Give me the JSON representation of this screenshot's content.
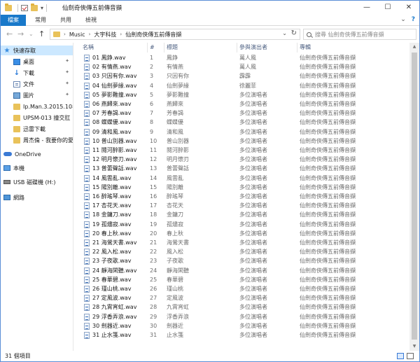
{
  "window": {
    "title": "仙劍奇俠傳五前傳音擷",
    "min_glyph": "—",
    "max_glyph": "☐",
    "close_glyph": "✕"
  },
  "quick_access": {
    "dropdown_glyph": "▾"
  },
  "ribbon": {
    "tabs": [
      "檔案",
      "常用",
      "共用",
      "檢視"
    ],
    "collapse_glyph": "⌄",
    "help_glyph": "?"
  },
  "nav": {
    "back_glyph": "←",
    "forward_glyph": "→",
    "recent_glyph": "⌄",
    "up_glyph": "↑"
  },
  "address": {
    "crumbs": [
      "Music",
      "大宇科技",
      "仙劍奇俠傳五前傳音擷"
    ],
    "chevron": "›",
    "dropdown_glyph": "⌄",
    "refresh_glyph": "↻"
  },
  "search": {
    "placeholder": "搜尋 仙劍奇俠傳五前傳音擷"
  },
  "sidebar": {
    "items": [
      {
        "label": "快速存取",
        "icon": "star-icon",
        "pinned": false
      },
      {
        "label": "桌面",
        "icon": "desktop-icon",
        "pinned": true
      },
      {
        "label": "下載",
        "icon": "download-icon",
        "pinned": true
      },
      {
        "label": "文件",
        "icon": "document-icon",
        "pinned": true
      },
      {
        "label": "圖片",
        "icon": "picture-icon",
        "pinned": true
      },
      {
        "label": "Ip.Man.3.2015.108",
        "icon": "folder-icon",
        "pinned": false
      },
      {
        "label": "UPSM-013 撞交肛",
        "icon": "folder-icon",
        "pinned": false
      },
      {
        "label": "迅雷下載",
        "icon": "folder-icon",
        "pinned": false
      },
      {
        "label": "周杰倫 - 我要你的愛",
        "icon": "folder-icon",
        "pinned": false
      },
      {
        "label": "OneDrive",
        "icon": "cloud-icon",
        "pinned": false
      },
      {
        "label": "本機",
        "icon": "pc-icon",
        "pinned": false
      },
      {
        "label": "USB 磁碟機 (H:)",
        "icon": "usb-icon",
        "pinned": false
      },
      {
        "label": "網路",
        "icon": "network-icon",
        "pinned": false
      }
    ],
    "pin_glyph": "📌"
  },
  "columns": {
    "name": "名稱",
    "number": "#",
    "title": "標題",
    "artist": "參與演出者",
    "album": "專輯",
    "sort_glyph": "^"
  },
  "files": [
    {
      "name": "01 鳳錚.wav",
      "num": "1",
      "title": "鳳錚",
      "artist": "萬人風",
      "album": "仙劍奇俠傳五前傳音擷"
    },
    {
      "name": "02 有情燕.wav",
      "num": "2",
      "title": "有情燕",
      "artist": "萬人風",
      "album": "仙劍奇俠傳五前傳音擷"
    },
    {
      "name": "03 只因有你.wav",
      "num": "3",
      "title": "只因有你",
      "artist": "霹霹",
      "album": "仙劍奇俠傳五前傳音擷"
    },
    {
      "name": "04 仙劍夢緣.wav",
      "num": "4",
      "title": "仙劍夢緣",
      "artist": "徐麗菲",
      "album": "仙劍奇俠傳五前傳音擷"
    },
    {
      "name": "05 夢影難撞.wav",
      "num": "5",
      "title": "夢影難撞",
      "artist": "多位演唱者",
      "album": "仙劍奇俠傳五前傳音擷"
    },
    {
      "name": "06 燕歸來.wav",
      "num": "6",
      "title": "燕歸來",
      "artist": "多位演唱者",
      "album": "仙劍奇俠傳五前傳音擷"
    },
    {
      "name": "07 芳春謁.wav",
      "num": "7",
      "title": "芳春謁",
      "artist": "多位演唱者",
      "album": "仙劍奇俠傳五前傳音擷"
    },
    {
      "name": "08 蝶蝶優.wav",
      "num": "8",
      "title": "蝶蝶優",
      "artist": "多位演唱者",
      "album": "仙劍奇俠傳五前傳音擷"
    },
    {
      "name": "09 清和風.wav",
      "num": "9",
      "title": "清和風",
      "artist": "多位演唱者",
      "album": "仙劍奇俠傳五前傳音擷"
    },
    {
      "name": "10 普山別器.wav",
      "num": "10",
      "title": "普山別器",
      "artist": "多位演唱者",
      "album": "仙劍奇俠傳五前傳音擷"
    },
    {
      "name": "11 鬩河醉影.wav",
      "num": "11",
      "title": "鬩河醉影",
      "artist": "多位演唱者",
      "album": "仙劍奇俠傳五前傳音擷"
    },
    {
      "name": "12 明月懷刃.wav",
      "num": "12",
      "title": "明月懷刃",
      "artist": "多位演唱者",
      "album": "仙劍奇俠傳五前傳音擷"
    },
    {
      "name": "13 普蕾聲話.wav",
      "num": "13",
      "title": "普蕾聲話",
      "artist": "多位演唱者",
      "album": "仙劍奇俠傳五前傳音擷"
    },
    {
      "name": "14 風雲亂.wav",
      "num": "14",
      "title": "風雲亂",
      "artist": "多位演唱者",
      "album": "仙劍奇俠傳五前傳音擷"
    },
    {
      "name": "15 陽別離.wav",
      "num": "15",
      "title": "陽別離",
      "artist": "多位演唱者",
      "album": "仙劍奇俠傳五前傳音擷"
    },
    {
      "name": "16 醉瑤琴.wav",
      "num": "16",
      "title": "醉瑤琴",
      "artist": "多位演唱者",
      "album": "仙劍奇俠傳五前傳音擷"
    },
    {
      "name": "17 杏花天.wav",
      "num": "17",
      "title": "杏花天",
      "artist": "多位演唱者",
      "album": "仙劍奇俠傳五前傳音擷"
    },
    {
      "name": "18 金鏞刀.wav",
      "num": "18",
      "title": "金鏞刀",
      "artist": "多位演唱者",
      "album": "仙劍奇俠傳五前傳音擷"
    },
    {
      "name": "19 孤燼寂.wav",
      "num": "19",
      "title": "孤燼寂",
      "artist": "多位演唱者",
      "album": "仙劍奇俠傳五前傳音擷"
    },
    {
      "name": "20 春上秋.wav",
      "num": "20",
      "title": "春上秋",
      "artist": "多位演唱者",
      "album": "仙劍奇俠傳五前傳音擷"
    },
    {
      "name": "21 海鶯天書.wav",
      "num": "21",
      "title": "海鶯天書",
      "artist": "多位演唱者",
      "album": "仙劍奇俠傳五前傳音擷"
    },
    {
      "name": "22 風入松.wav",
      "num": "22",
      "title": "風入松",
      "artist": "多位演唱者",
      "album": "仙劍奇俠傳五前傳音擷"
    },
    {
      "name": "23 子夜歌.wav",
      "num": "23",
      "title": "子夜歌",
      "artist": "多位演唱者",
      "album": "仙劍奇俠傳五前傳音擷"
    },
    {
      "name": "24 靜海閑聽.wav",
      "num": "24",
      "title": "靜海閑聽",
      "artist": "多位演唱者",
      "album": "仙劍奇俠傳五前傳音擷"
    },
    {
      "name": "25 春華碧.wav",
      "num": "25",
      "title": "春華碧",
      "artist": "多位演唱者",
      "album": "仙劍奇俠傳五前傳音擷"
    },
    {
      "name": "26 瑾山桃.wav",
      "num": "26",
      "title": "瑾山桃",
      "artist": "多位演唱者",
      "album": "仙劍奇俠傳五前傳音擷"
    },
    {
      "name": "27 定風波.wav",
      "num": "27",
      "title": "定風波",
      "artist": "多位演唱者",
      "album": "仙劍奇俠傳五前傳音擷"
    },
    {
      "name": "28 九霄宵虹.wav",
      "num": "28",
      "title": "九霄宵虹",
      "artist": "多位演唱者",
      "album": "仙劍奇俠傳五前傳音擷"
    },
    {
      "name": "29 浮香弄浪.wav",
      "num": "29",
      "title": "浮香弄浪",
      "artist": "多位演唱者",
      "album": "仙劍奇俠傳五前傳音擷"
    },
    {
      "name": "30 劍器近.wav",
      "num": "30",
      "title": "劍器近",
      "artist": "多位演唱者",
      "album": "仙劍奇俠傳五前傳音擷"
    },
    {
      "name": "31 止水箋.wav",
      "num": "31",
      "title": "止水箋",
      "artist": "多位演唱者",
      "album": "仙劍奇俠傳五前傳音擷"
    }
  ],
  "scroll": {
    "up_glyph": "▲",
    "down_glyph": "▼"
  },
  "status": {
    "count": "31 個項目"
  },
  "colors": {
    "accent": "#1979ca",
    "selection": "#cce8ff",
    "folder": "#e9c25a"
  }
}
